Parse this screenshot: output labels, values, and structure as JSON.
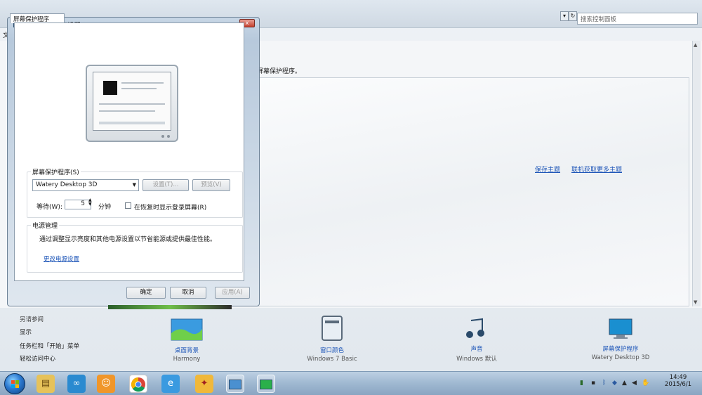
{
  "control_panel": {
    "search_placeholder": "搜索控制面板",
    "menu_file": "文",
    "description": "屏幕保护程序。",
    "save_theme": "保存主题",
    "more_themes": "联机获取更多主题",
    "see_also": {
      "title": "另请参阅",
      "items": [
        "显示",
        "任务栏和「开始」菜单",
        "轻松访问中心"
      ]
    },
    "tiles": [
      {
        "label": "桌面背景",
        "sub": "Harmony",
        "icon": "desktop-background-icon"
      },
      {
        "label": "窗口颜色",
        "sub": "Windows 7 Basic",
        "icon": "window-color-icon"
      },
      {
        "label": "声音",
        "sub": "Windows 默认",
        "icon": "sound-icon"
      },
      {
        "label": "屏幕保护程序",
        "sub": "Watery Desktop 3D",
        "icon": "screensaver-icon"
      }
    ]
  },
  "dialog": {
    "title": "屏幕保护程序设置",
    "close": "x",
    "tab": "屏幕保护程序",
    "screensaver_group": "屏幕保护程序(S)",
    "screensaver_value": "Watery Desktop 3D",
    "settings_button": "设置(T)...",
    "preview_button": "预览(V)",
    "wait_label": "等待(W):",
    "wait_value": "5",
    "minutes": "分钟",
    "resume_checkbox": "在恢复时显示登录屏幕(R)",
    "power_group": "电源管理",
    "power_text": "通过调整显示亮度和其他电源设置以节省能源或提供最佳性能。",
    "power_link": "更改电源设置",
    "ok": "确定",
    "cancel": "取消",
    "apply": "应用(A)"
  },
  "taskbar": {
    "clock_time": "14:49",
    "clock_date": "2015/6/1"
  },
  "colors": {
    "link": "#1e56b8",
    "taskbar": "#9fb8d1"
  }
}
